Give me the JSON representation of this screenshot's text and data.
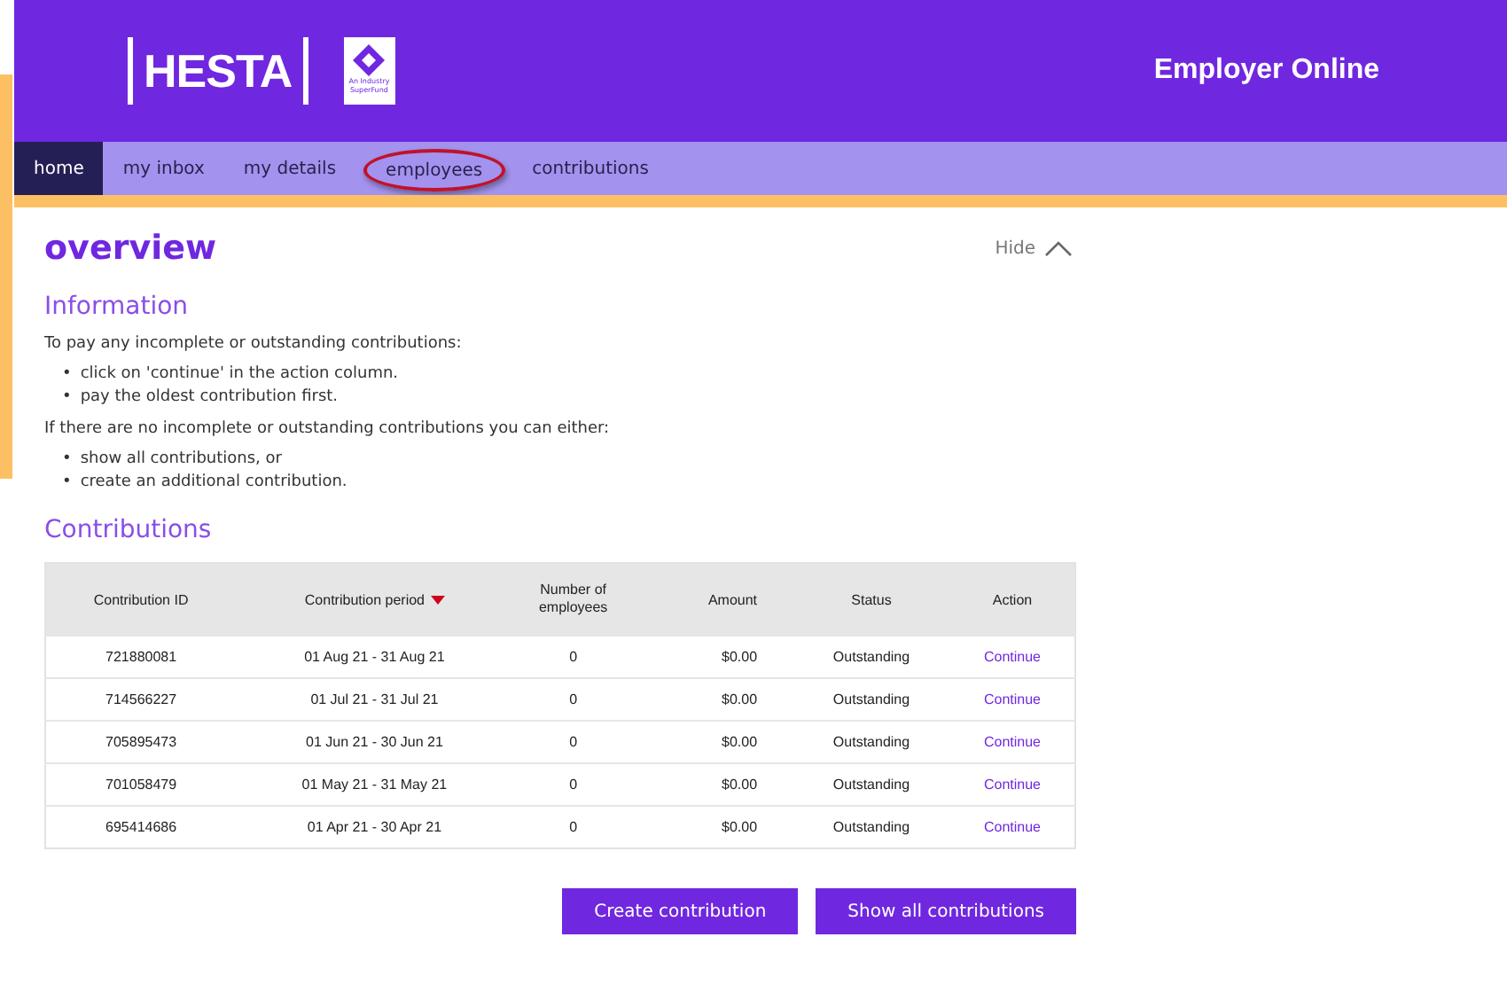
{
  "header": {
    "brand": "HESTA",
    "badge_text": "An Industry SuperFund",
    "portal_title": "Employer Online"
  },
  "nav": [
    {
      "label": "home",
      "selected": true,
      "highlighted": false
    },
    {
      "label": "my inbox",
      "selected": false,
      "highlighted": false
    },
    {
      "label": "my details",
      "selected": false,
      "highlighted": false
    },
    {
      "label": "employees",
      "selected": false,
      "highlighted": true
    },
    {
      "label": "contributions",
      "selected": false,
      "highlighted": false
    }
  ],
  "page_title": "overview",
  "hide_toggle": {
    "label": "Hide",
    "expanded": true
  },
  "information": {
    "heading": "Information",
    "bullet": "•",
    "intro": "To pay any incomplete or outstanding contributions:",
    "steps": [
      "click on 'continue' in the action column.",
      "pay the oldest contribution first."
    ],
    "alt_intro": "If there are no incomplete or outstanding contributions you can either:",
    "alternatives": [
      "show all contributions, or",
      "create an additional contribution."
    ]
  },
  "contributions": {
    "heading": "Contributions",
    "columns": [
      {
        "label": "Contribution ID",
        "sorted": false
      },
      {
        "label": "Contribution period",
        "sorted": true
      },
      {
        "label": "Number of employees",
        "sorted": false
      },
      {
        "label": "Amount",
        "sorted": false
      },
      {
        "label": "Status",
        "sorted": false
      },
      {
        "label": "Action",
        "sorted": false
      }
    ],
    "rows": [
      {
        "id": "721880081",
        "period": "01 Aug 21 - 31 Aug 21",
        "employees": "0",
        "amount": "$0.00",
        "status": "Outstanding",
        "action": "Continue"
      },
      {
        "id": "714566227",
        "period": "01 Jul 21 - 31 Jul 21",
        "employees": "0",
        "amount": "$0.00",
        "status": "Outstanding",
        "action": "Continue"
      },
      {
        "id": "705895473",
        "period": "01 Jun 21 - 30 Jun 21",
        "employees": "0",
        "amount": "$0.00",
        "status": "Outstanding",
        "action": "Continue"
      },
      {
        "id": "701058479",
        "period": "01 May 21 - 31 May 21",
        "employees": "0",
        "amount": "$0.00",
        "status": "Outstanding",
        "action": "Continue"
      },
      {
        "id": "695414686",
        "period": "01 Apr 21 - 30 Apr 21",
        "employees": "0",
        "amount": "$0.00",
        "status": "Outstanding",
        "action": "Continue"
      }
    ]
  },
  "buttons": [
    "Create contribution",
    "Show all contributions"
  ]
}
